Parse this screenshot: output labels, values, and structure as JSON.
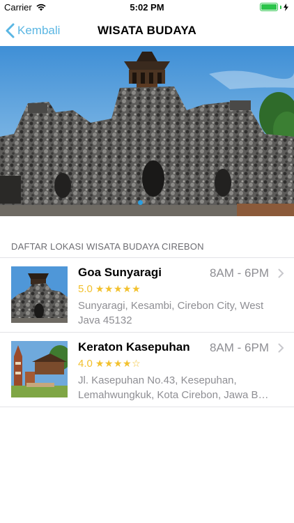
{
  "status_bar": {
    "carrier": "Carrier",
    "time": "5:02 PM",
    "battery_level": 1.0,
    "battery_color": "#2bc44a"
  },
  "nav": {
    "back_label": "Kembali",
    "title": "WISATA BUDAYA",
    "accent_color": "#5ab6e3"
  },
  "hero": {
    "page_count": 1,
    "active_page": 1
  },
  "section": {
    "header": "DAFTAR LOKASI WISATA BUDAYA CIREBON"
  },
  "items": [
    {
      "name": "Goa Sunyaragi",
      "hours": "8AM - 6PM",
      "rating": "5.0",
      "stars": "★★★★★",
      "address_line1": "Sunyaragi, Kesambi, Cirebon City, West",
      "address_line2": "Java 45132",
      "thumb_icon": "rock-cave-temple-photo"
    },
    {
      "name": "Keraton Kasepuhan",
      "hours": "8AM - 6PM",
      "rating": "4.0",
      "stars": "★★★★☆",
      "address_line1": "Jl. Kasepuhan No.43, Kesepuhan,",
      "address_line2": "Lemahwungkuk, Kota Cirebon, Jawa Bar...",
      "thumb_icon": "palace-gate-photo"
    }
  ],
  "icons": {
    "wifi": "wifi-icon",
    "battery": "battery-icon",
    "charging": "bolt-icon",
    "back": "chevron-left-icon",
    "disclosure": "chevron-right-icon"
  }
}
